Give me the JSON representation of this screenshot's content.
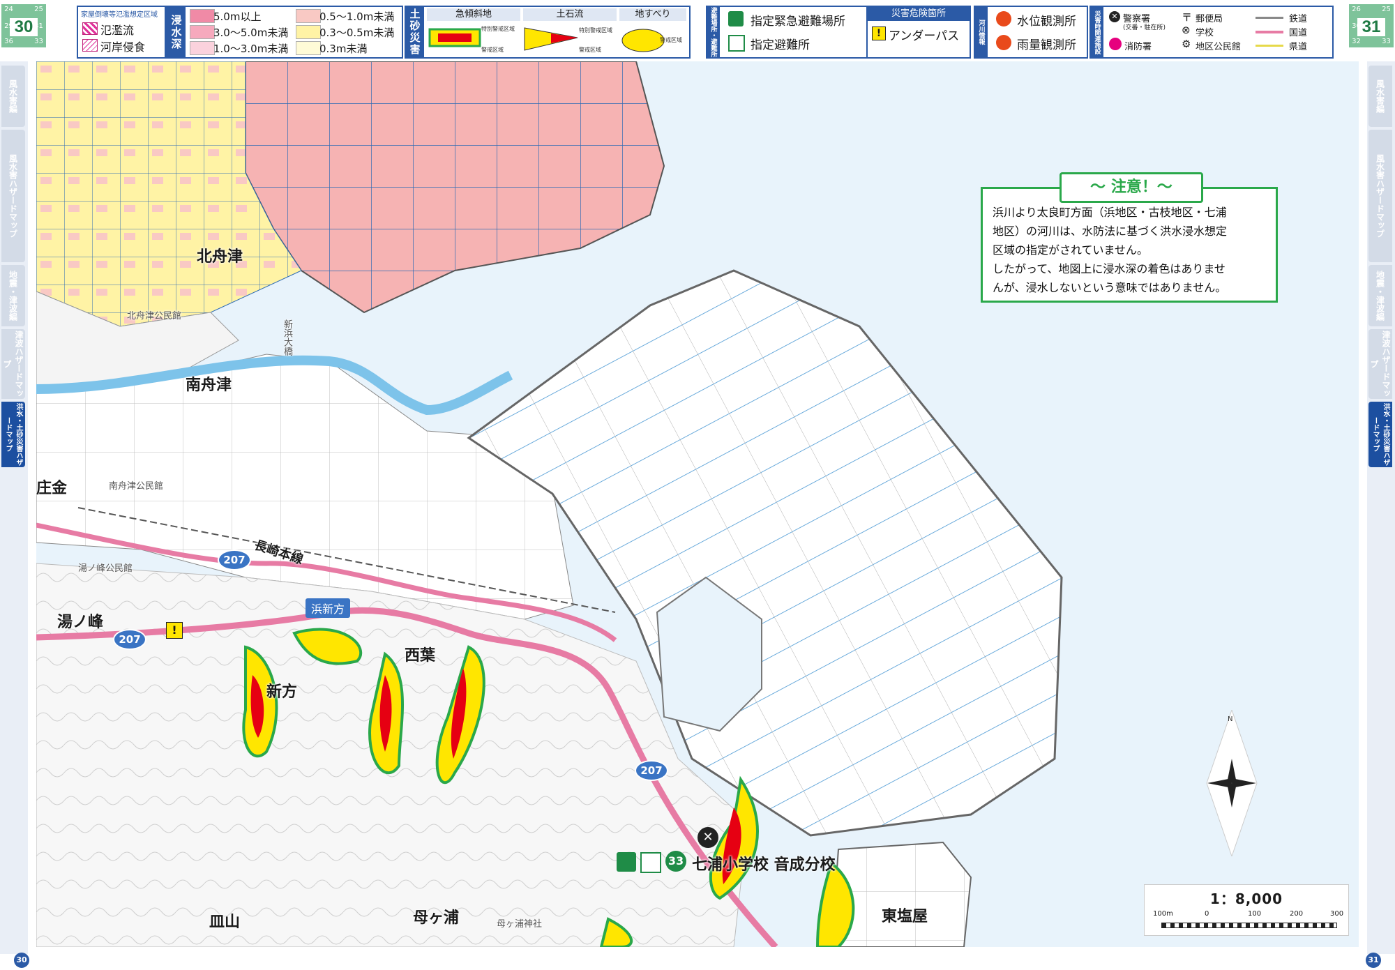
{
  "page_nav_left": {
    "cells": [
      "24",
      "25",
      "28",
      "29",
      "31",
      "36",
      "32",
      "33"
    ],
    "current": "30"
  },
  "page_nav_right": {
    "cells": [
      "26",
      "25",
      "26",
      "30",
      "32",
      "33"
    ],
    "current": "31"
  },
  "legend": {
    "collapse": {
      "title": "家屋倒壊等氾濫想定区域",
      "items": [
        "氾濫流",
        "河岸侵食"
      ]
    },
    "depth": {
      "title": "浸水深",
      "items": [
        {
          "label": "5.0m以上",
          "color": "#f08aa6"
        },
        {
          "label": "3.0〜5.0m未満",
          "color": "#f6a9bd"
        },
        {
          "label": "1.0〜3.0m未満",
          "color": "#fbd2dd"
        },
        {
          "label": "0.5〜1.0m未満",
          "color": "#f9c9c4"
        },
        {
          "label": "0.3〜0.5m未満",
          "color": "#fff3a5"
        },
        {
          "label": "0.3m未満",
          "color": "#fffbd7"
        }
      ]
    },
    "sediment": {
      "title": "土砂災害",
      "columns": [
        "急傾斜地",
        "土石流",
        "地すべり"
      ],
      "notes": [
        "特別警戒区域",
        "警戒区域",
        "特別警戒区域",
        "警戒区域",
        "警戒区域"
      ]
    },
    "shelter": {
      "title": "避難場所・避難所",
      "items": [
        "指定緊急避難場所",
        "指定避難所"
      ]
    },
    "danger": {
      "title": "災害危険箇所",
      "items": [
        "アンダーパス"
      ]
    },
    "river": {
      "title": "河川情報",
      "items": [
        "水位観測所",
        "雨量観測所"
      ]
    },
    "facility": {
      "title": "災害時関連施設",
      "items": [
        "警察署",
        "(交番・駐在所)",
        "消防署",
        "郵便局",
        "学校",
        "地区公民館"
      ],
      "lines": [
        "鉄道",
        "国道",
        "県道"
      ]
    }
  },
  "sidebar_left": {
    "tabs": [
      "風水害編",
      "風水害ハザードマップ",
      "地震・津波編",
      "津波ハザードマップ",
      "洪水・土砂災害ハザードマップ"
    ]
  },
  "sidebar_right": {
    "tabs": [
      "風水害編",
      "風水害ハザードマップ",
      "地震・津波編",
      "津波ハザードマップ",
      "洪水・土砂災害ハザードマップ"
    ]
  },
  "map": {
    "places": [
      "北舟津",
      "南舟津",
      "庄金",
      "湯ノ峰",
      "新方",
      "西葉",
      "皿山",
      "母ヶ浦",
      "東塩屋"
    ],
    "small_labels": [
      "北舟津公民館",
      "南舟津公民館",
      "湯ノ峰公民館",
      "新浜大橋",
      "母ヶ浦神社"
    ],
    "rail": "長崎本線",
    "underpass": "浜新方",
    "routes": [
      "207",
      "207",
      "207"
    ],
    "school": {
      "number": "33",
      "name": "七浦小学校 音成分校"
    }
  },
  "notice": {
    "title": "〜 注意！〜",
    "body": [
      "浜川より太良町方面（浜地区・古枝地区・七浦",
      "地区）の河川は、水防法に基づく洪水浸水想定",
      "区域の指定がされていません。",
      "したがって、地図上に浸水深の着色はありませ",
      "んが、浸水しないという意味ではありません。"
    ]
  },
  "scale": {
    "ratio": "1：8,000",
    "ticks": [
      "100m",
      "0",
      "100",
      "200",
      "300"
    ],
    "north": "N"
  },
  "page_numbers": [
    "30",
    "31"
  ],
  "colors": {
    "accent_blue": "#2b5aa6",
    "notice_green": "#2aa84a",
    "sea": "#e8f3fb",
    "rail_pink": "#e77ba4"
  }
}
